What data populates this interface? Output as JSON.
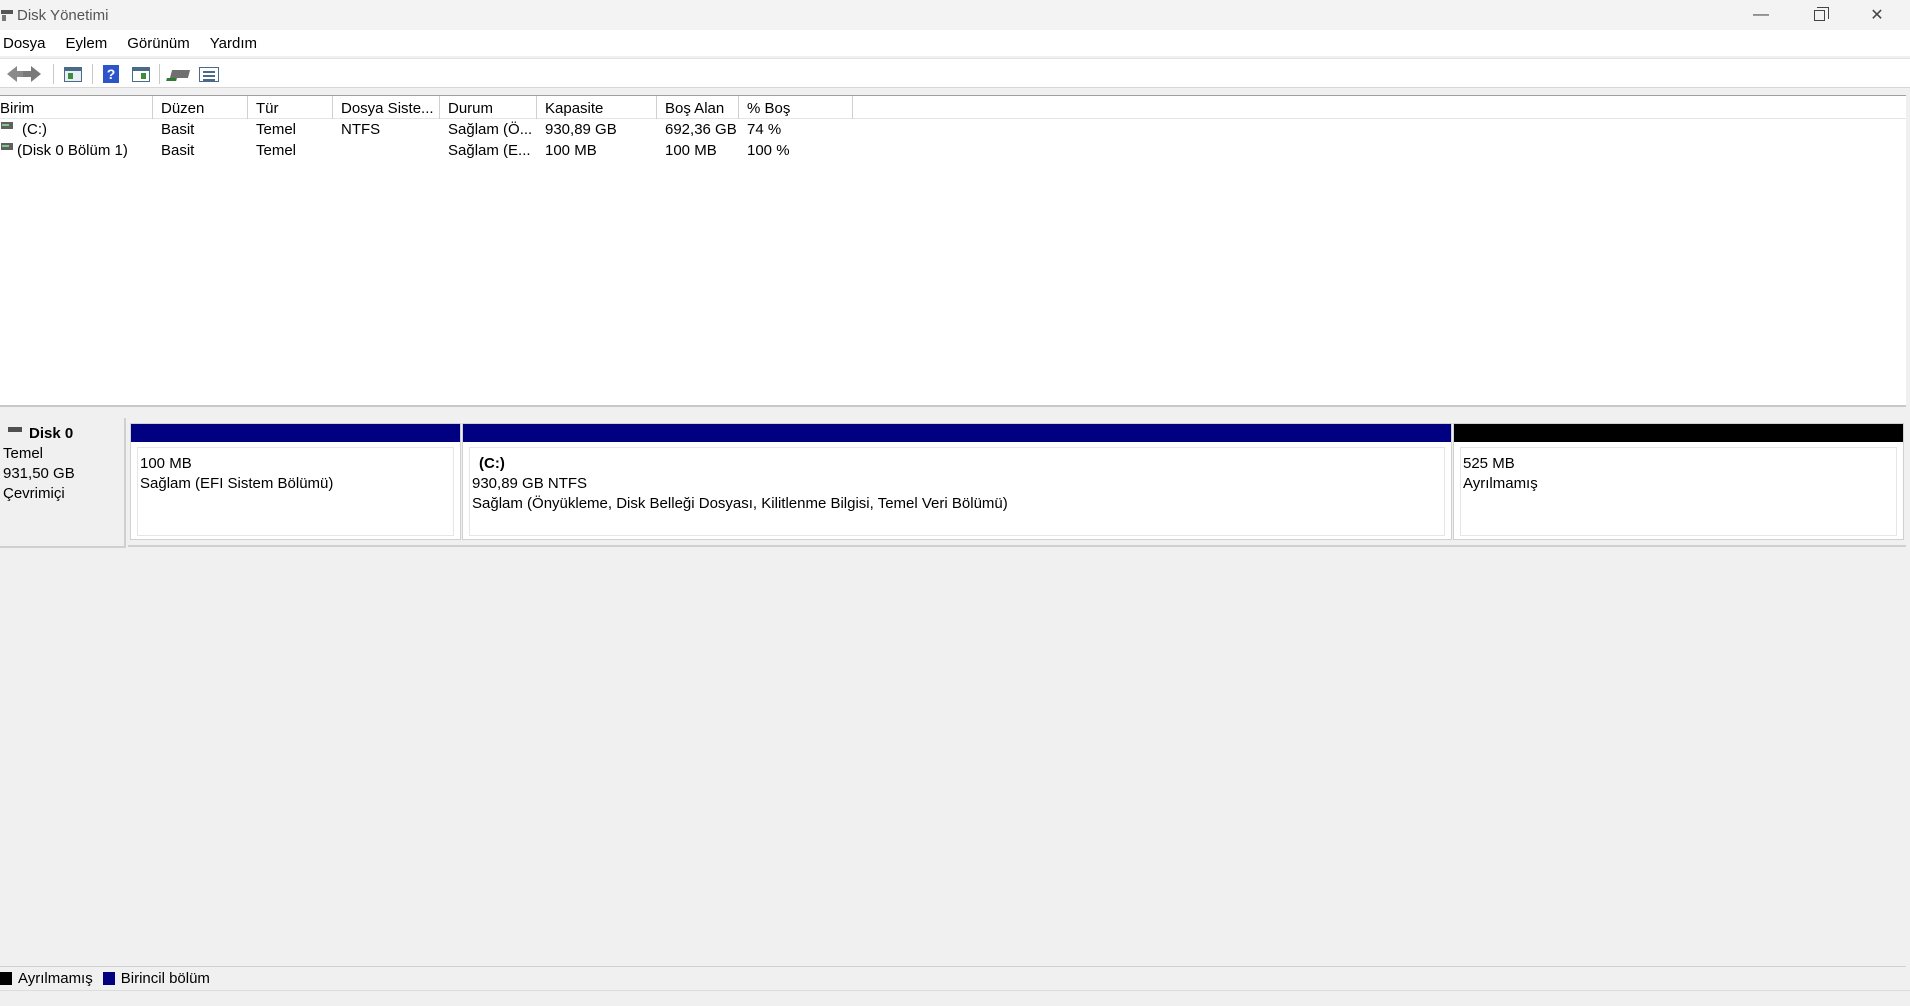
{
  "window": {
    "title": "Disk Yönetimi",
    "minimize_glyph": "—",
    "close_glyph": "✕"
  },
  "menu": [
    "Dosya",
    "Eylem",
    "Görünüm",
    "Yardım"
  ],
  "toolbar": {
    "icons": [
      "back-arrow-icon",
      "forward-arrow-icon",
      "console-tree-icon",
      "help-icon",
      "properties-panel-icon",
      "rescan-disks-icon",
      "list-view-icon"
    ],
    "help_glyph": "?"
  },
  "volume_list": {
    "columns": [
      "Birim",
      "Düzen",
      "Tür",
      "Dosya Siste...",
      "Durum",
      "Kapasite",
      "Boş Alan",
      "% Boş"
    ],
    "rows": [
      [
        "(C:)",
        "Basit",
        "Temel",
        "NTFS",
        "Sağlam (Ö...",
        "930,89 GB",
        "692,36 GB",
        "74 %"
      ],
      [
        "(Disk 0 Bölüm 1)",
        "Basit",
        "Temel",
        "",
        "Sağlam (E...",
        "100 MB",
        "100 MB",
        "100 %"
      ]
    ]
  },
  "disk": {
    "name": "Disk 0",
    "type": "Temel",
    "size": "931,50 GB",
    "status": "Çevrimiçi",
    "partitions": [
      {
        "name": "",
        "size": "100 MB",
        "status": "Sağlam (EFI Sistem Bölümü)",
        "bar_color": "#000080"
      },
      {
        "name": "(C:)",
        "size": "930,89 GB NTFS",
        "status": "Sağlam (Önyükleme, Disk Belleği Dosyası, Kilitlenme Bilgisi, Temel Veri Bölümü)",
        "bar_color": "#000080"
      },
      {
        "name": "",
        "size": "525 MB",
        "status": "Ayrılmamış",
        "bar_color": "#000000"
      }
    ]
  },
  "legend": [
    {
      "label": "Ayrılmamış",
      "color": "#000000"
    },
    {
      "label": "Birincil bölüm",
      "color": "#000080"
    }
  ]
}
